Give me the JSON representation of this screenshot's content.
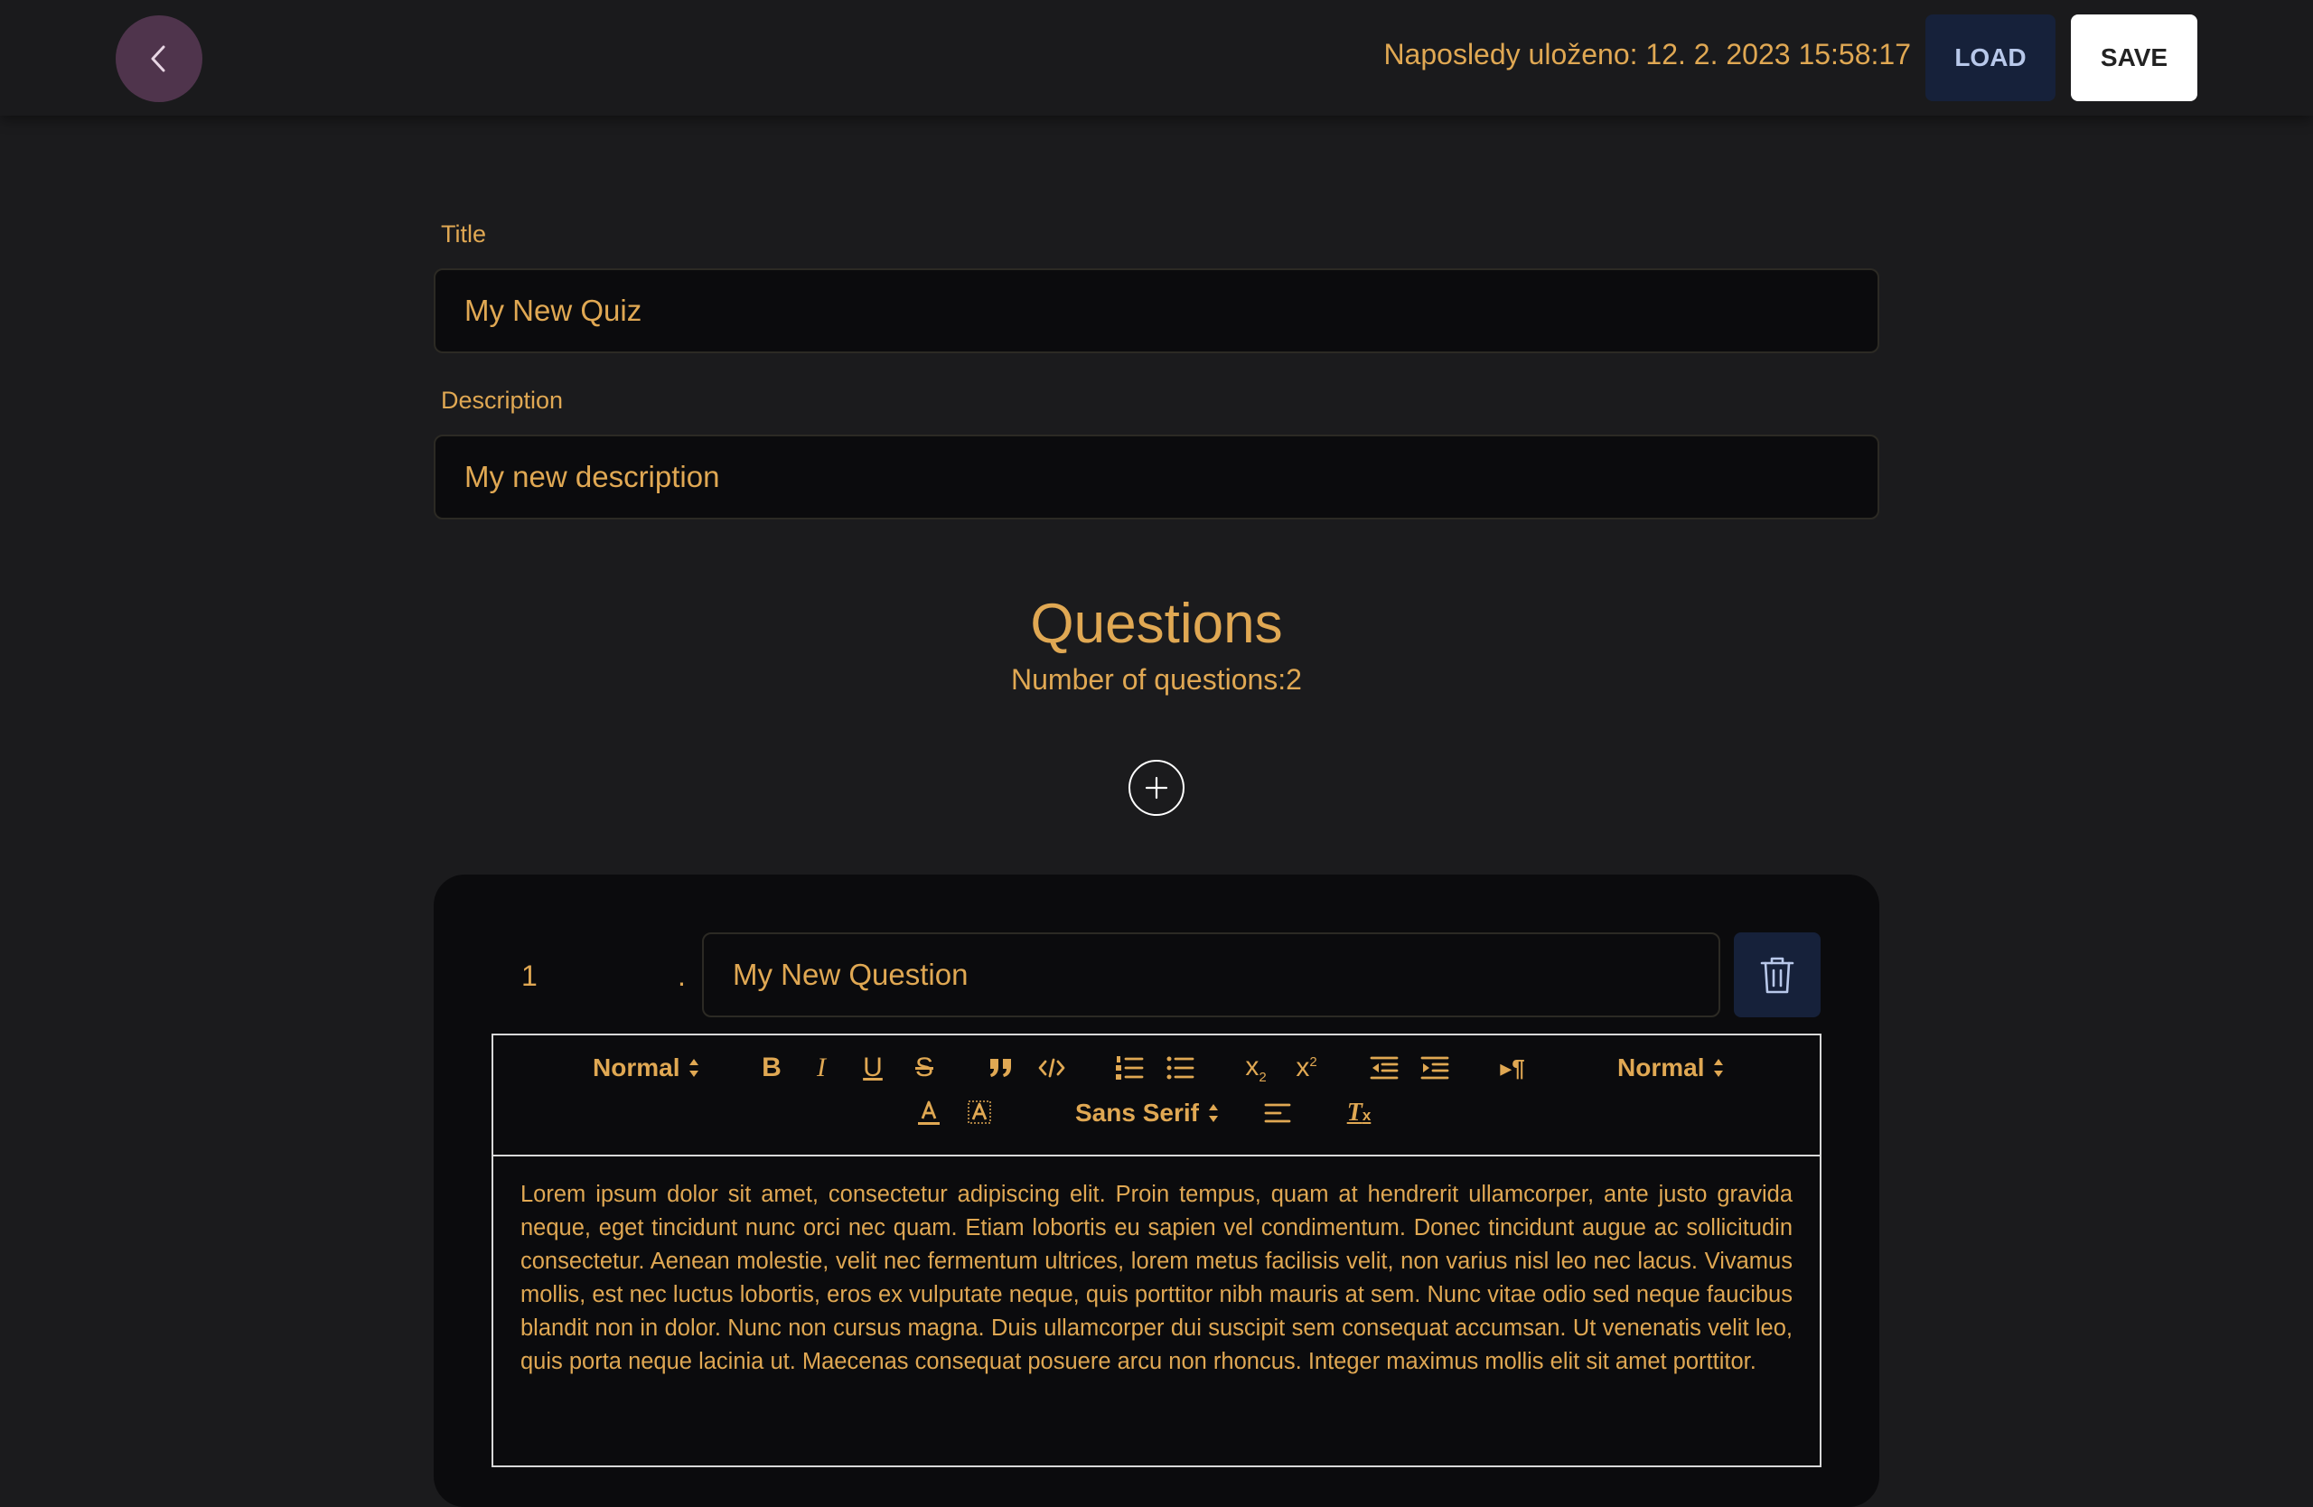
{
  "header": {
    "last_saved": "Naposledy uloženo: 12. 2. 2023 15:58:17",
    "load_label": "LOAD",
    "save_label": "SAVE"
  },
  "form": {
    "title_label": "Title",
    "title_value": "My New Quiz",
    "description_label": "Description",
    "description_value": "My new description"
  },
  "questions": {
    "heading": "Questions",
    "count_text": "Number of questions:2",
    "items": [
      {
        "number": "1",
        "separator": ".",
        "text": "My New Question",
        "body": "Lorem ipsum dolor sit amet, consectetur adipiscing elit. Proin tempus, quam at hendrerit ullamcorper, ante justo gravida neque, eget tincidunt nunc orci nec quam. Etiam lobortis eu sapien vel condimentum. Donec tincidunt augue ac sollicitudin consectetur. Aenean molestie, velit nec fermentum ultrices, lorem metus facilisis velit, non varius nisl leo nec lacus. Vivamus mollis, est nec luctus lobortis, eros ex vulputate neque, quis porttitor nibh mauris at sem. Nunc vitae odio sed neque faucibus blandit non in dolor. Nunc non cursus magna. Duis ullamcorper dui suscipit sem consequat accumsan. Ut venenatis velit leo, quis porta neque lacinia ut. Maecenas consequat posuere arcu non rhoncus. Integer maximus mollis elit sit amet porttitor."
      }
    ]
  },
  "toolbar": {
    "header_picker": "Normal",
    "size_picker": "Normal",
    "font_picker": "Sans Serif"
  },
  "colors": {
    "accent": "#e0a853",
    "background": "#1b1b1d",
    "card": "#0b0b0d",
    "back_button": "#4f344c",
    "load_button": "#16213a",
    "save_button": "#ffffff"
  },
  "icons": {
    "back": "chevron-left-icon",
    "add": "plus-icon",
    "delete": "trash-icon"
  }
}
